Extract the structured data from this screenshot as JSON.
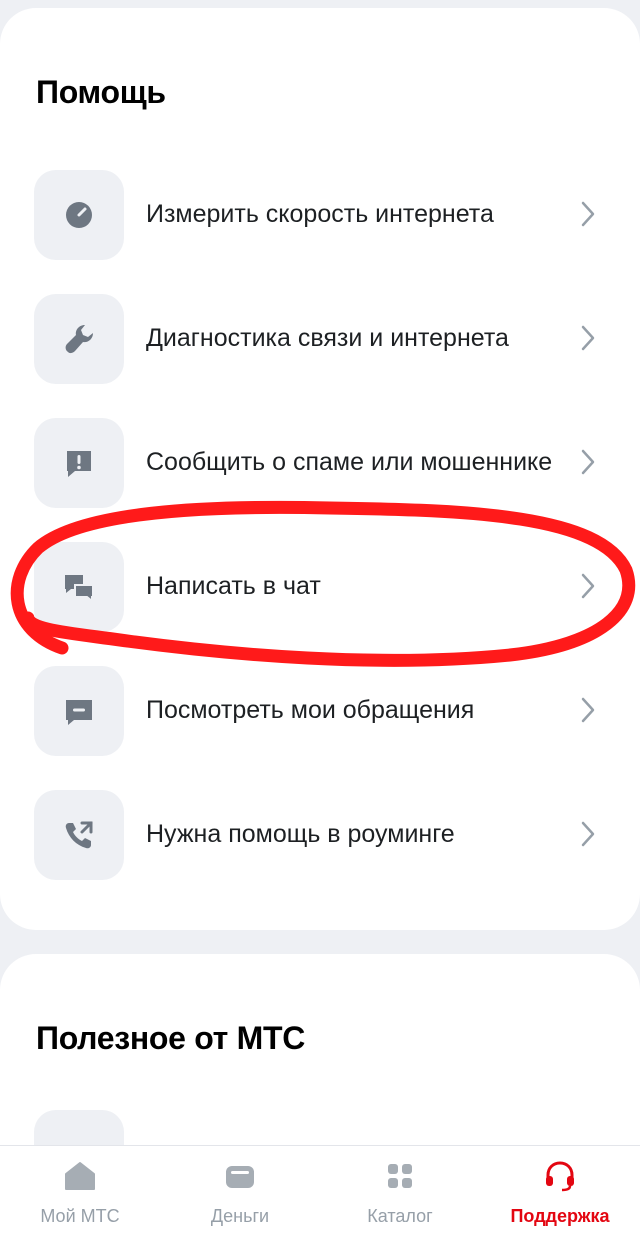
{
  "help": {
    "title": "Помощь",
    "items": [
      {
        "label": "Измерить скорость интернета",
        "icon": "speedometer-icon"
      },
      {
        "label": "Диагностика связи и интернета",
        "icon": "wrench-icon"
      },
      {
        "label": "Сообщить о спаме или мошеннике",
        "icon": "alert-message-icon"
      },
      {
        "label": "Написать в чат",
        "icon": "chat-bubbles-icon"
      },
      {
        "label": "Посмотреть мои обращения",
        "icon": "message-icon"
      },
      {
        "label": "Нужна помощь в роуминге",
        "icon": "phone-forward-icon"
      }
    ]
  },
  "useful": {
    "title": "Полезное от МТС"
  },
  "bottom_nav": {
    "items": [
      {
        "label": "Мой МТС",
        "icon": "home-icon",
        "active": false
      },
      {
        "label": "Деньги",
        "icon": "wallet-icon",
        "active": false
      },
      {
        "label": "Каталог",
        "icon": "grid-icon",
        "active": false
      },
      {
        "label": "Поддержка",
        "icon": "headset-icon",
        "active": true
      }
    ]
  },
  "colors": {
    "accent": "#e30611",
    "icon_gray": "#6e7782",
    "tile_bg": "#eef0f4",
    "annotation_red": "#ff1a1a"
  }
}
